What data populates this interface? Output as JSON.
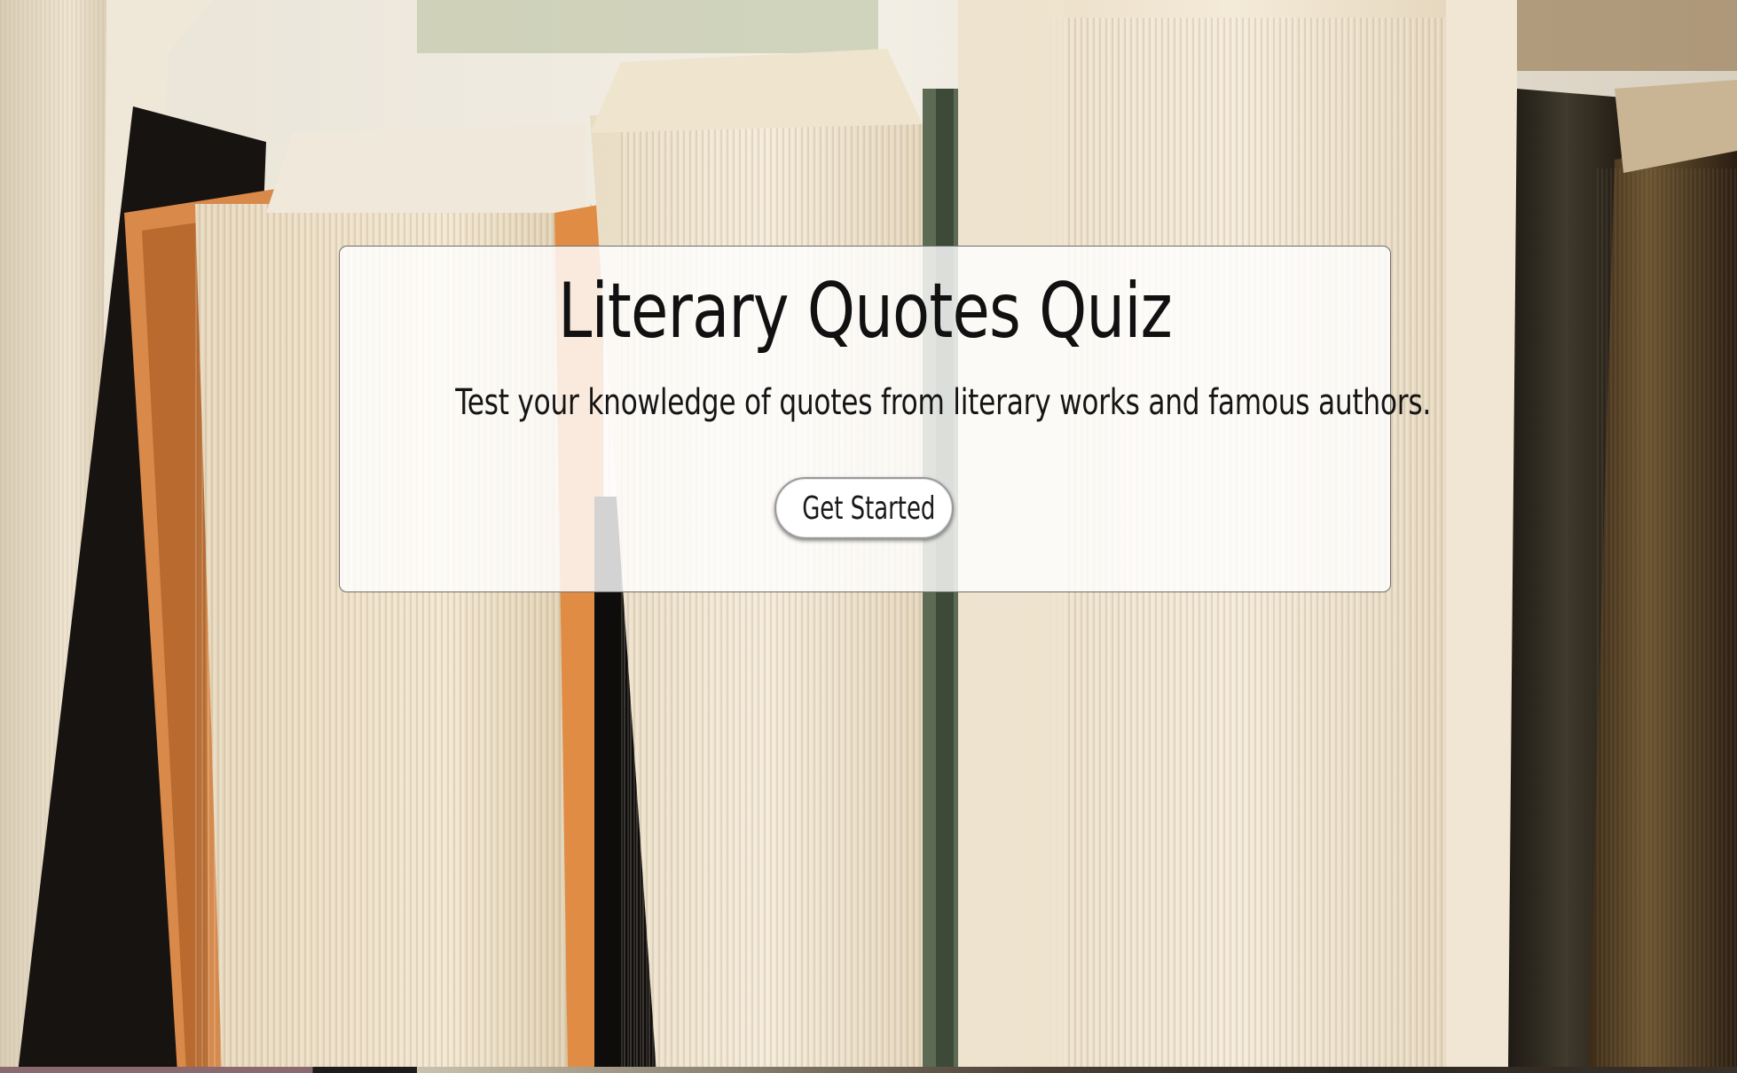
{
  "hero": {
    "title": "Literary Quotes Quiz",
    "subtitle": "Test your knowledge of quotes from literary works and famous authors.",
    "start_button_label": "Get Started"
  },
  "background": {
    "subject": "books-photo"
  },
  "colors": {
    "card_background": "#ffffffd1",
    "card_border": "#6d6d6d",
    "text": "#111111",
    "button_background": "#ffffff"
  }
}
